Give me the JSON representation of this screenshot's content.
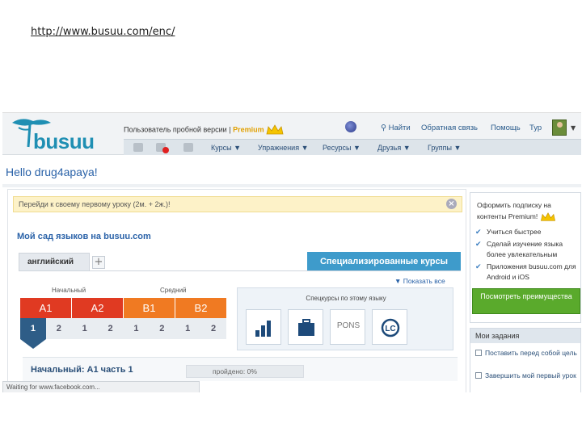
{
  "caption_url": "http://www.busuu.com/enc/",
  "brand": {
    "name": "busuu",
    "color": "#1f8fb3"
  },
  "header": {
    "trial_user_label": "Пользователь пробной версии",
    "separator": "|",
    "premium_label": "Premium",
    "search_label": "Найти",
    "feedback_label": "Обратная связь",
    "help_label": "Помощь",
    "user_short": "Тур"
  },
  "nav": {
    "items": [
      "Курсы ▼",
      "Упражнения ▼",
      "Ресурсы ▼",
      "Друзья ▼",
      "Группы ▼"
    ]
  },
  "greeting": "Hello drug4apaya!",
  "banner": {
    "text": "Перейди к своему первому уроку (2м. + 2ж.)!",
    "close": "×"
  },
  "garden_title": "Мой сад языков на busuu.com",
  "language_tab": "английский",
  "add_tab": "+",
  "special_courses": "Специализированные курсы",
  "levels": {
    "head_beginner": "Начальный",
    "head_intermediate": "Средний",
    "items": [
      {
        "label": "A1",
        "color": "#e03a22"
      },
      {
        "label": "A2",
        "color": "#e03a22"
      },
      {
        "label": "B1",
        "color": "#f07a22"
      },
      {
        "label": "B2",
        "color": "#f07a22"
      }
    ],
    "subs": [
      "1",
      "2",
      "1",
      "2",
      "1",
      "2",
      "1",
      "2"
    ]
  },
  "special_box": {
    "show_all": "▼ Показать все",
    "heading": "Спецкурсы по этому языку",
    "items": [
      {
        "icon": "chart-icon",
        "label": ""
      },
      {
        "icon": "briefcase-icon",
        "label": ""
      },
      {
        "icon": "pons-icon",
        "label": "PONS"
      },
      {
        "icon": "lc-icon",
        "label": "LC"
      }
    ]
  },
  "current": {
    "title": "Начальный: A1 часть 1",
    "progress_text": "пройдено: 0%",
    "progress_value": 0
  },
  "statusbar": "Waiting for www.facebook.com...",
  "subscription": {
    "title": "Оформить подписку на контенты Premium!",
    "checks": [
      "Учиться быстрее",
      "Сделай изучение языка более увлекательным",
      "Приложения busuu.com для Android и iOS"
    ],
    "button": "Посмотреть преимущества"
  },
  "tasks": {
    "heading": "Мои задания",
    "items": [
      "Поставить перед собой цель",
      "Завершить мой первый урок"
    ]
  }
}
